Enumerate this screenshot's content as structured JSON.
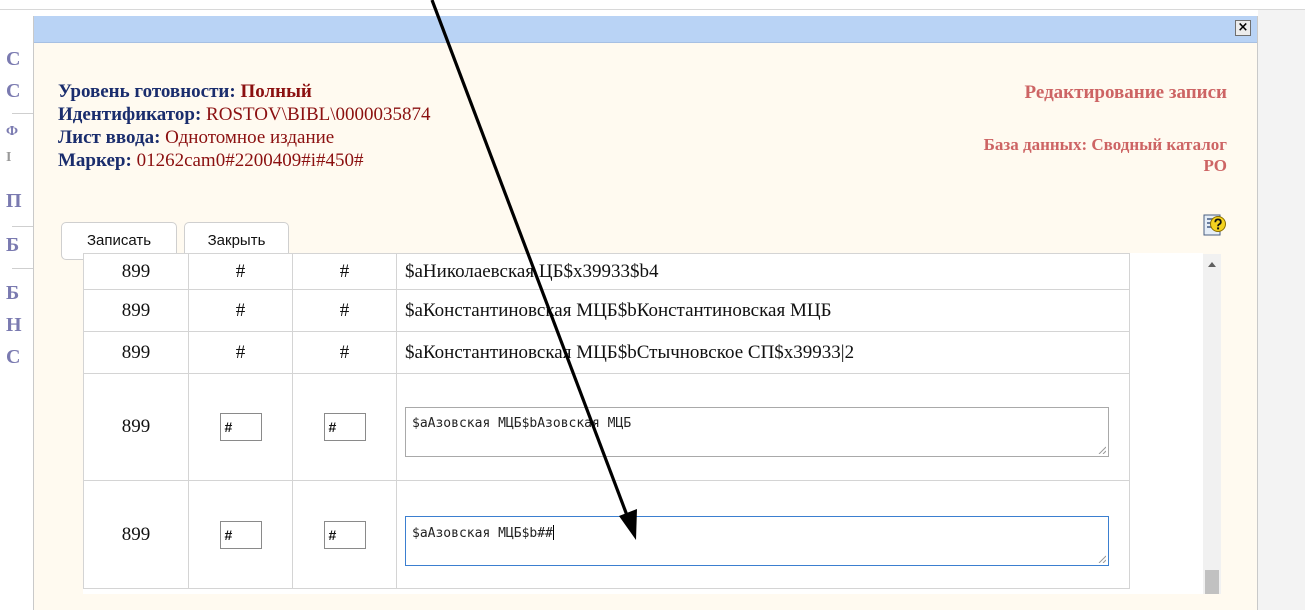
{
  "background": {
    "letters": [
      "С",
      "С",
      "Ф",
      "І",
      "П",
      "Б",
      "Б",
      "Н",
      "С"
    ]
  },
  "dialog": {
    "close_glyph": "×",
    "info": {
      "status_label": "Уровень готовности:",
      "status_value": "Полный",
      "id_label": "Идентификатор:",
      "id_value": "ROSTOV\\BIBL\\0000035874",
      "sheet_label": "Лист ввода:",
      "sheet_value": "Однотомное издание",
      "marker_label": "Маркер:",
      "marker_value": "01262cam0#2200409#i#450#"
    },
    "right_title": "Редактирование записи",
    "database": "База данных: Сводный каталог РО",
    "buttons": {
      "save": "Записать",
      "close": "Закрыть"
    }
  },
  "rows": [
    {
      "tag": "899",
      "ind1": "#",
      "ind2": "#",
      "value": "$аНиколаевская ЦБ$x39933$b4"
    },
    {
      "tag": "899",
      "ind1": "#",
      "ind2": "#",
      "value": "$аКонстантиновская МЦБ$bКонстантиновская МЦБ"
    },
    {
      "tag": "899",
      "ind1": "#",
      "ind2": "#",
      "value": "$аКонстантиновская МЦБ$bСтычновское СП$x39933|2"
    }
  ],
  "edit_rows": [
    {
      "tag": "899",
      "ind1": "#",
      "ind2": "#",
      "value": "$аАзовская МЦБ$bАзовская МЦБ"
    },
    {
      "tag": "899",
      "ind1": "#",
      "ind2": "#",
      "value": "$аАзовская МЦБ$b##"
    }
  ],
  "colors": {
    "titlebar": "#b9d3f5",
    "label": "#1a2d6d",
    "value": "#8b1010",
    "accent": "#cd6464"
  }
}
